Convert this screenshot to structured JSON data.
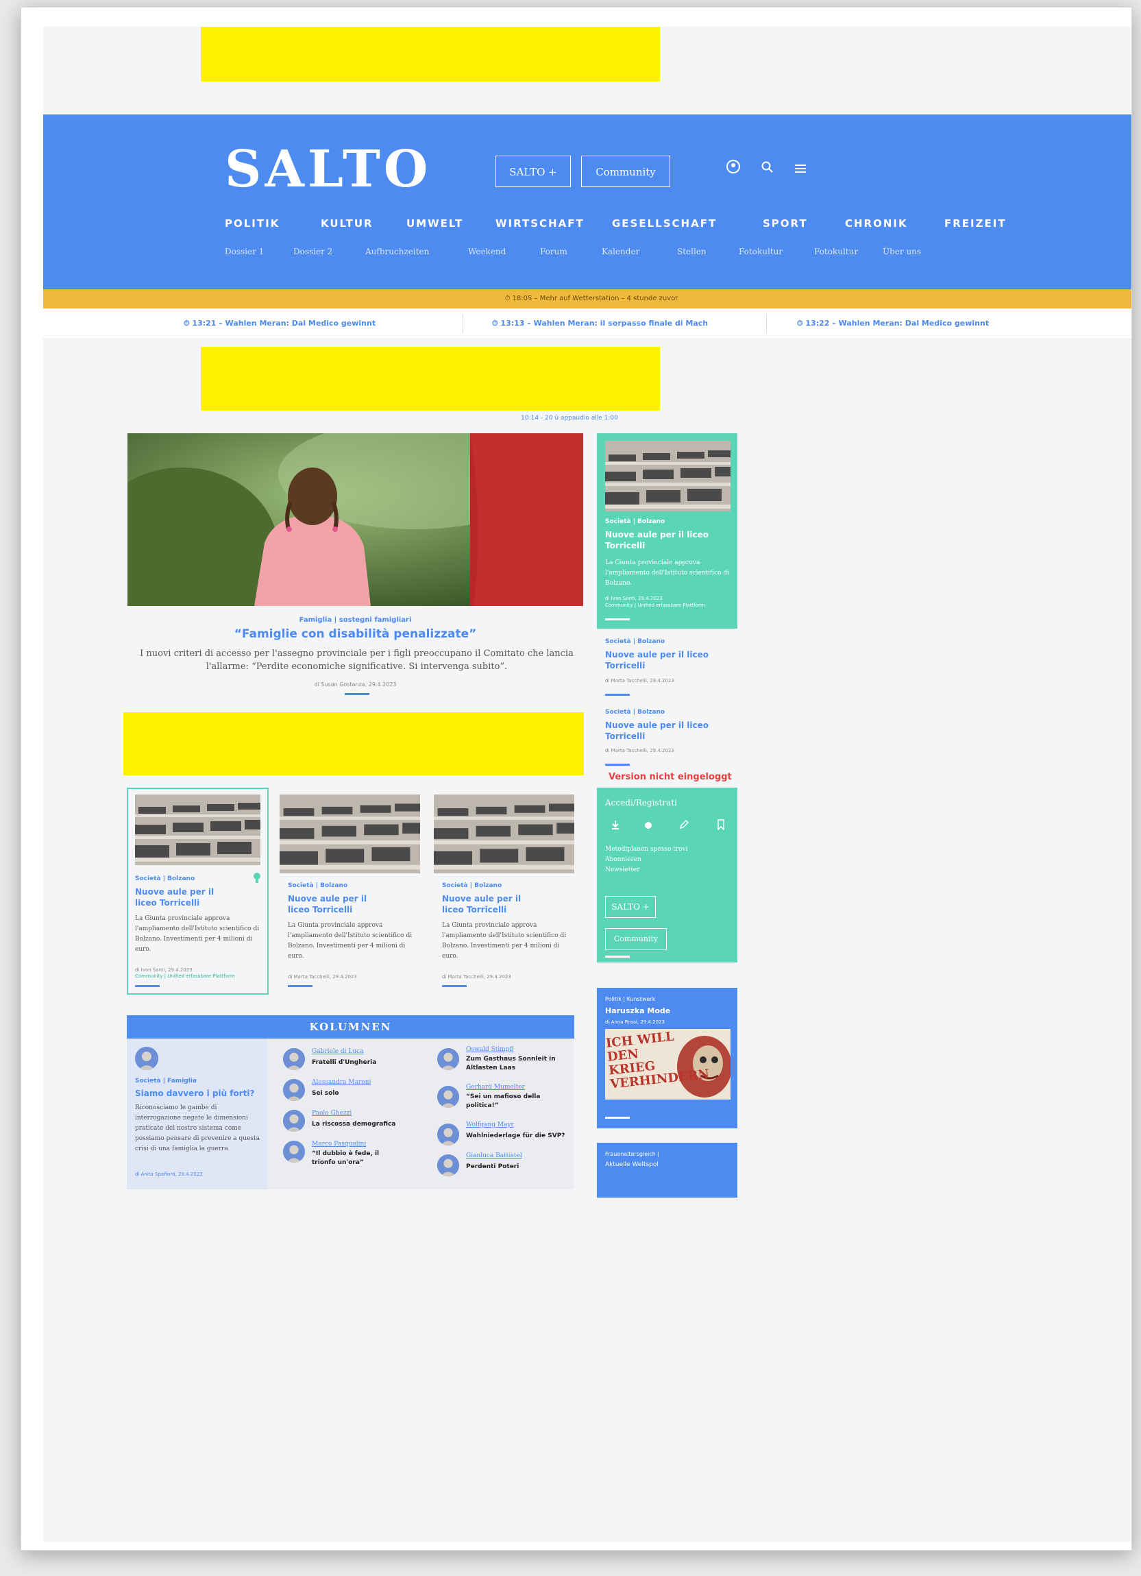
{
  "header": {
    "logo": "SALTO",
    "salto_button": "SALTO +",
    "community_button": "Community",
    "icons": [
      "user-circle-icon",
      "search-icon",
      "menu-icon"
    ],
    "nav": [
      "POLITIK",
      "KULTUR",
      "UMWELT",
      "WIRTSCHAFT",
      "GESELLSCHAFT",
      "SPORT",
      "CHRONIK",
      "FREIZEIT"
    ],
    "subnav": [
      "Dossier 1",
      "Dossier 2",
      "Aufbruchzeiten",
      "Weekend",
      "Forum",
      "Kalender",
      "Stellen",
      "Fotokultur",
      "Fotokultur",
      "Über uns"
    ]
  },
  "breaking": "⏱ 18:05 – Mehr auf Wetterstation – 4 stunde zuvor",
  "ticker": [
    "⏱ 13:21 – Wahlen Meran: Dal Medico gewinnt",
    "⏱ 13:13 – Wahlen Meran: il sorpasso finale di Mach",
    "⏱ 13:22 – Wahlen Meran: Dal Medico gewinnt"
  ],
  "ad_label": "10:14 - 20 ü appaudio alle 1:00",
  "hero": {
    "kicker": "Famiglia | sostegni famigliari",
    "title": "“Famiglie con disabilità penalizzate”",
    "text": "I nuovi criteri di accesso per l'assegno provinciale per i figli preoccupano il Comitato che lancia l'allarme: “Perdite economiche significative. Si intervenga subito”.",
    "meta": "di Susan Gostanza, 29.4.2023"
  },
  "sidebar_cards": [
    {
      "kicker": "Società | Bolzano",
      "title": "Nuove aule per il liceo Torricelli",
      "text": "La Giunta provinciale approva l'ampliamento dell'Istituto scientifico di Bolzano.",
      "meta": "di Ivan Santi, 29.4.2023",
      "meta2": "Community | Unified erfassbare Plattform"
    },
    {
      "kicker": "Società | Bolzano",
      "title": "Nuove aule per il liceo Torricelli",
      "meta": "di Marta Tacchelli, 29.4.2023"
    },
    {
      "kicker": "Società | Bolzano",
      "title": "Nuove aule per il liceo Torricelli",
      "meta": "di Marta Tacchelli, 29.4.2023"
    }
  ],
  "version_note": "Version nicht eingeloggt",
  "login_box": {
    "title": "Accedi/Registrati",
    "icons": [
      "download-icon",
      "circle-icon",
      "edit-icon",
      "bookmark-icon"
    ],
    "links": [
      "Metodiplanen spesso trovi",
      "Abonnieren",
      "Newsletter"
    ],
    "salto_button": "SALTO +",
    "community_button": "Community"
  },
  "grid_cards": [
    {
      "kicker": "Società | Bolzano",
      "title": "Nuove aule per il liceo Torricelli",
      "text": "La Giunta provinciale approva l'ampliamento dell'Istituto scientifico di Bolzano. Investimenti per 4 milioni di euro.",
      "meta": "di Ivan Santi, 29.4.2023",
      "meta2": "Community | Unified erfassbare Plattform"
    },
    {
      "kicker": "Società | Bolzano",
      "title": "Nuove aule per il liceo Torricelli",
      "text": "La Giunta provinciale approva l'ampliamento dell'Istituto scientifico di Bolzano. Investimenti per 4 milioni di euro.",
      "meta": "di Marta Tacchelli, 29.4.2023"
    },
    {
      "kicker": "Società | Bolzano",
      "title": "Nuove aule per il liceo Torricelli",
      "text": "La Giunta provinciale approva l'ampliamento dell'Istituto scientifico di Bolzano. Investimenti per 4 milioni di euro.",
      "meta": "di Marta Tacchelli, 29.4.2023"
    }
  ],
  "kolumnen": {
    "title": "KOLUMNEN",
    "feature": {
      "kicker": "Società | Famiglia",
      "title": "Siamo davvero i più forti?",
      "text": "Riconosciamo le gambe di interrogazione negate le dimensioni praticate del nostro sistema come possiamo pensare di prevenire a questa crisi di una famiglia la guerra",
      "meta": "di Anita Spafford, 29.4.2023"
    },
    "col2": [
      {
        "name": "Gabriele di Luca",
        "title": "Fratelli d'Ungheria"
      },
      {
        "name": "Alessandra Maroni",
        "title": "Sei solo"
      },
      {
        "name": "Paolo Ghezzi",
        "title": "La riscossa demografica"
      },
      {
        "name": "Marco Pasqualini",
        "title": "“Il dubbio è fede, il trionfo un'ora”"
      }
    ],
    "col3": [
      {
        "name": "Oswald Stimpfl",
        "title": "Zum Gasthaus Sonnleit in Altlasten Laas"
      },
      {
        "name": "Gerhard Mumelter",
        "title": "“Sei un mafioso della politica!”"
      },
      {
        "name": "Wolfgang Mayr",
        "title": "Wahlniederlage für die SVP?"
      },
      {
        "name": "Gianluca Battistel",
        "title": "Perdenti Poteri"
      }
    ]
  },
  "sidebar_blue_card": {
    "kicker": "Politik | Kunstwerk",
    "title": "Haruszka Mode",
    "meta": "di Anna Rossi, 29.4.2023",
    "image_text": "ICH WILL DEN KRIEG VERHINDERN"
  },
  "sidebar_blue_card2": {
    "kicker": "Frauenaltersgleich |",
    "title": "Aktuelle Weltspol"
  }
}
